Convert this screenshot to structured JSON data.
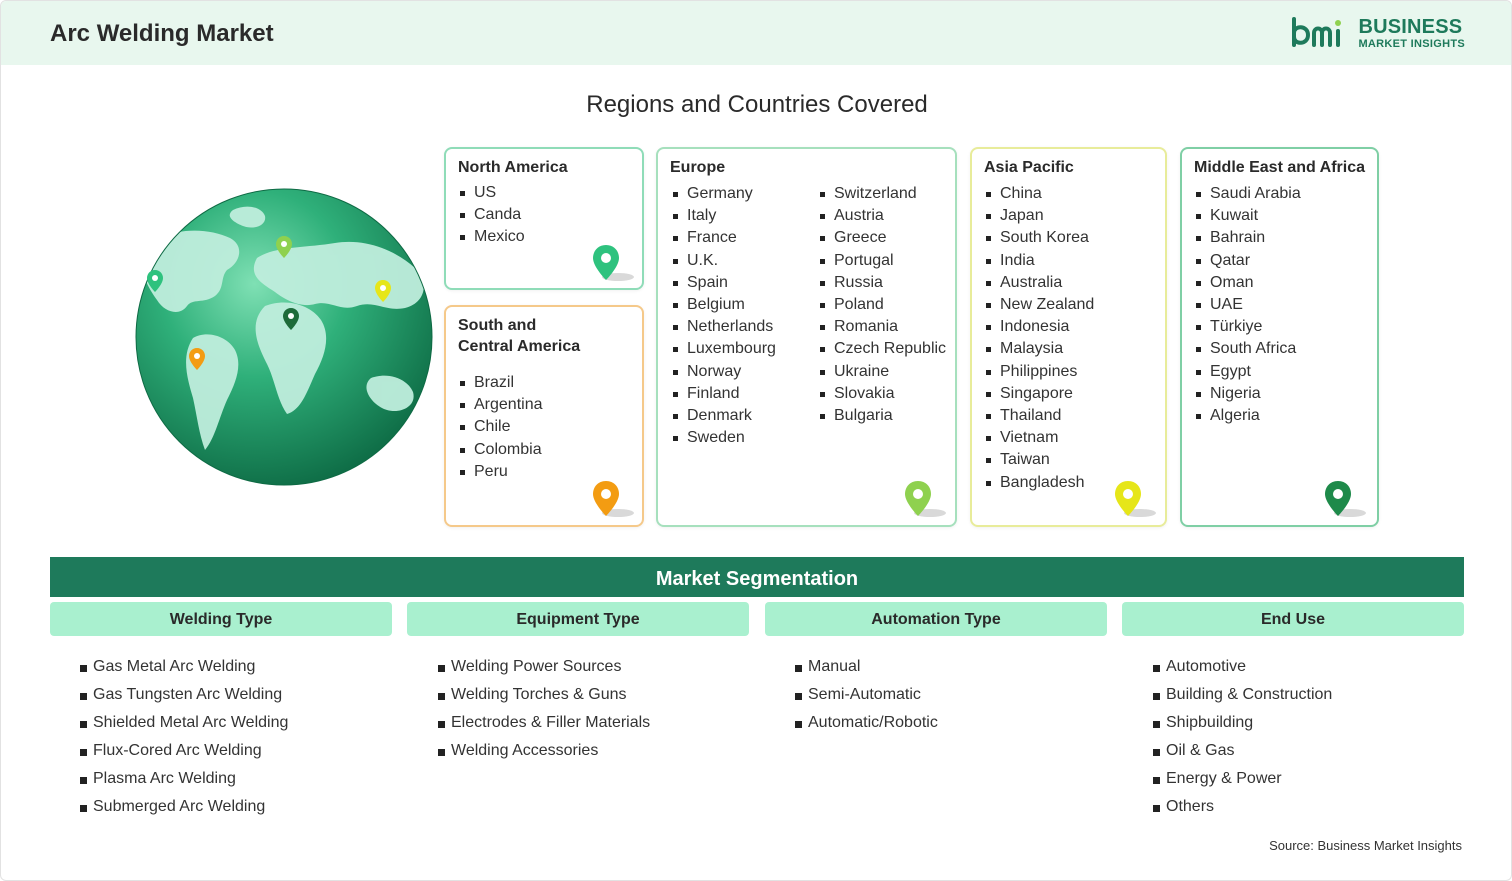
{
  "header": {
    "title": "Arc Welding Market"
  },
  "logo": {
    "line1": "BUSINESS",
    "line2": "MARKET INSIGHTS",
    "mark_icon": "bmi-logo-icon",
    "color": "#1e7a5b"
  },
  "regions_title": "Regions and Countries Covered",
  "regions": {
    "north_america": {
      "name": "North America",
      "countries": [
        "US",
        "Canda",
        "Mexico"
      ],
      "pin_color": "#2ec27e"
    },
    "south_central_america": {
      "name_line1": "South and",
      "name_line2": "Central America",
      "countries": [
        "Brazil",
        "Argentina",
        "Chile",
        "Colombia",
        "Peru"
      ],
      "pin_color": "#f39c12"
    },
    "europe": {
      "name": "Europe",
      "countries_col1": [
        "Germany",
        "Italy",
        "France",
        "U.K.",
        "Spain",
        "Belgium",
        "Netherlands",
        "Luxembourg",
        "Norway",
        "Finland",
        "Denmark",
        "Sweden"
      ],
      "countries_col2": [
        "Switzerland",
        "Austria",
        "Greece",
        "Portugal",
        "Russia",
        "Poland",
        "Romania",
        "Czech Republic",
        "Ukraine",
        "Slovakia",
        "Bulgaria"
      ],
      "pin_color": "#8fd14f"
    },
    "asia_pacific": {
      "name": "Asia Pacific",
      "countries": [
        "China",
        "Japan",
        "South Korea",
        "India",
        "Australia",
        "New Zealand",
        "Indonesia",
        "Malaysia",
        "Philippines",
        "Singapore",
        "Thailand",
        "Vietnam",
        "Taiwan",
        "Bangladesh"
      ],
      "pin_color": "#e6e619"
    },
    "middle_east_africa": {
      "name": "Middle East and Africa",
      "countries": [
        "Saudi Arabia",
        "Kuwait",
        "Bahrain",
        "Qatar",
        "Oman",
        "UAE",
        "Türkiye",
        "South Africa",
        "Egypt",
        "Nigeria",
        "Algeria"
      ],
      "pin_color": "#1e8a4a"
    }
  },
  "segmentation": {
    "title": "Market Segmentation",
    "columns": [
      {
        "header": "Welding Type",
        "items": [
          "Gas Metal Arc Welding",
          "Gas Tungsten Arc Welding",
          "Shielded Metal Arc Welding",
          "Flux-Cored Arc Welding",
          "Plasma Arc Welding",
          "Submerged Arc Welding"
        ]
      },
      {
        "header": "Equipment Type",
        "items": [
          "Welding Power Sources",
          "Welding Torches & Guns",
          "Electrodes & Filler Materials",
          "Welding Accessories"
        ]
      },
      {
        "header": "Automation Type",
        "items": [
          "Manual",
          "Semi-Automatic",
          "Automatic/Robotic"
        ]
      },
      {
        "header": "End Use",
        "items": [
          "Automotive",
          "Building & Construction",
          "Shipbuilding",
          "Oil & Gas",
          "Energy & Power",
          "Others"
        ]
      }
    ]
  },
  "source": "Source: Business Market Insights",
  "colors": {
    "accent": "#1e7a5b",
    "header_bg": "#e8f7ee",
    "segment_header_bg": "#a9f0cf"
  }
}
